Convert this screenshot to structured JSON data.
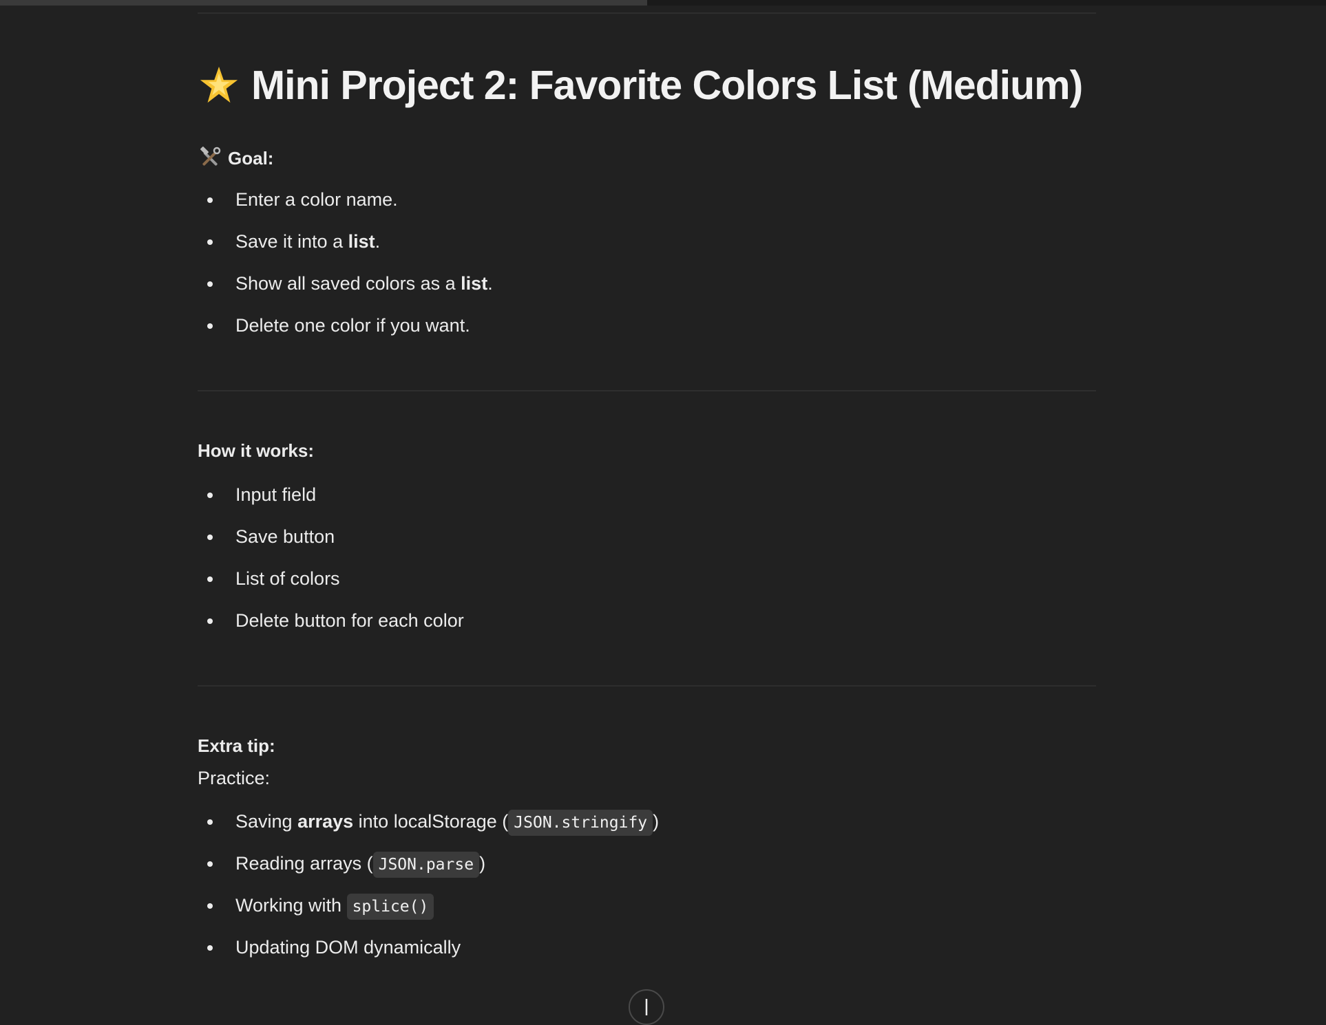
{
  "page": {
    "title": "Mini Project 2: Favorite Colors List (Medium)",
    "title_icon": "glowing-star",
    "scroll_progress": 0.49
  },
  "goal": {
    "heading": "Goal:",
    "heading_icon": "hammer-and-wrench",
    "items": [
      {
        "parts": [
          "Enter a color name."
        ]
      },
      {
        "pre": "Save it into a ",
        "bold": "list",
        "post": "."
      },
      {
        "pre": "Show all saved colors as a ",
        "bold": "list",
        "post": "."
      },
      {
        "parts": [
          "Delete one color if you want."
        ]
      }
    ]
  },
  "how_it_works": {
    "heading": "How it works:",
    "items": [
      "Input field",
      "Save button",
      "List of colors",
      "Delete button for each color"
    ]
  },
  "extra_tip": {
    "heading": "Extra tip:",
    "intro": "Practice:",
    "items": [
      {
        "pre": "Saving ",
        "bold": "arrays",
        "mid": " into localStorage (",
        "code": "JSON.stringify",
        "post": ")"
      },
      {
        "pre": "Reading arrays (",
        "code": "JSON.parse",
        "post": ")"
      },
      {
        "pre": "Working with ",
        "code": "splice()",
        "post": ""
      },
      {
        "pre": "Updating DOM dynamically"
      }
    ]
  },
  "colors": {
    "background": "#212121",
    "text": "#ececec",
    "code_bg": "#3b3b3b",
    "divider": "#2e2e2e"
  }
}
